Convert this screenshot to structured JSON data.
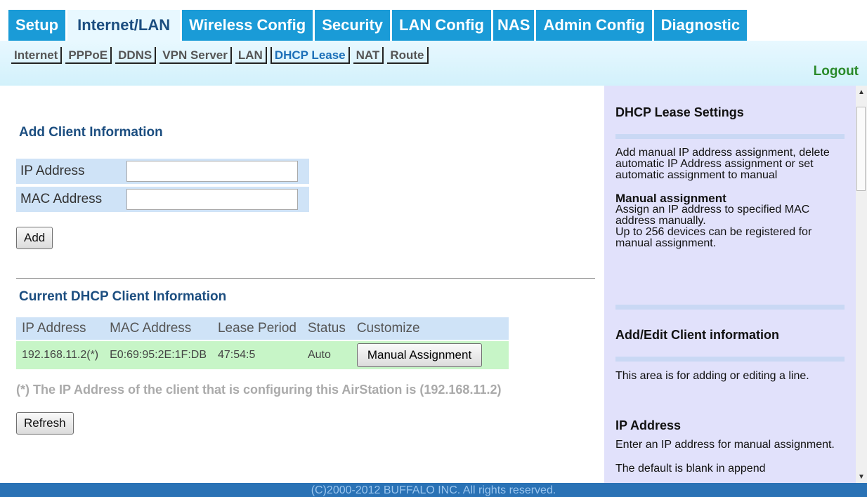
{
  "nav": {
    "tabs": [
      {
        "label": "Setup"
      },
      {
        "label": "Internet/LAN"
      },
      {
        "label": "Wireless Config"
      },
      {
        "label": "Security"
      },
      {
        "label": "LAN Config"
      },
      {
        "label": "NAS"
      },
      {
        "label": "Admin Config"
      },
      {
        "label": "Diagnostic"
      }
    ],
    "active_tab": "Internet/LAN",
    "subtabs": [
      {
        "label": "Internet"
      },
      {
        "label": "PPPoE"
      },
      {
        "label": "DDNS"
      },
      {
        "label": "VPN Server"
      },
      {
        "label": "LAN"
      },
      {
        "label": "DHCP Lease"
      },
      {
        "label": "NAT"
      },
      {
        "label": "Route"
      }
    ],
    "active_subtab": "DHCP Lease",
    "logout": "Logout"
  },
  "add_client": {
    "title": "Add Client Information",
    "ip_label": "IP Address",
    "ip_value": "",
    "mac_label": "MAC Address",
    "mac_value": "",
    "add_button": "Add"
  },
  "current": {
    "title": "Current DHCP Client Information",
    "columns": [
      "IP Address",
      "MAC Address",
      "Lease Period",
      "Status",
      "Customize"
    ],
    "rows": [
      {
        "ip": "192.168.11.2(*)",
        "mac": "E0:69:95:2E:1F:DB",
        "lease": "47:54:5",
        "status": "Auto",
        "action": "Manual Assignment"
      }
    ],
    "note": "(*) The IP Address of the client that is configuring this AirStation is (192.168.11.2)",
    "refresh_button": "Refresh"
  },
  "help": {
    "title1": "DHCP Lease Settings",
    "text1": "Add manual IP address assignment, delete automatic IP Address assignment or set automatic assignment to manual",
    "bold1": "Manual assignment",
    "text2": "Assign an IP address to specified MAC address manually.",
    "text3": "Up to 256 devices can be registered for manual assignment.",
    "title2": "Add/Edit Client information",
    "text4": "This area is for adding or editing a line.",
    "title3": "IP Address",
    "text5": "Enter an IP address for manual assignment.",
    "text6": "The default is blank in append"
  },
  "footer": "(C)2000-2012 BUFFALO INC. All rights reserved."
}
